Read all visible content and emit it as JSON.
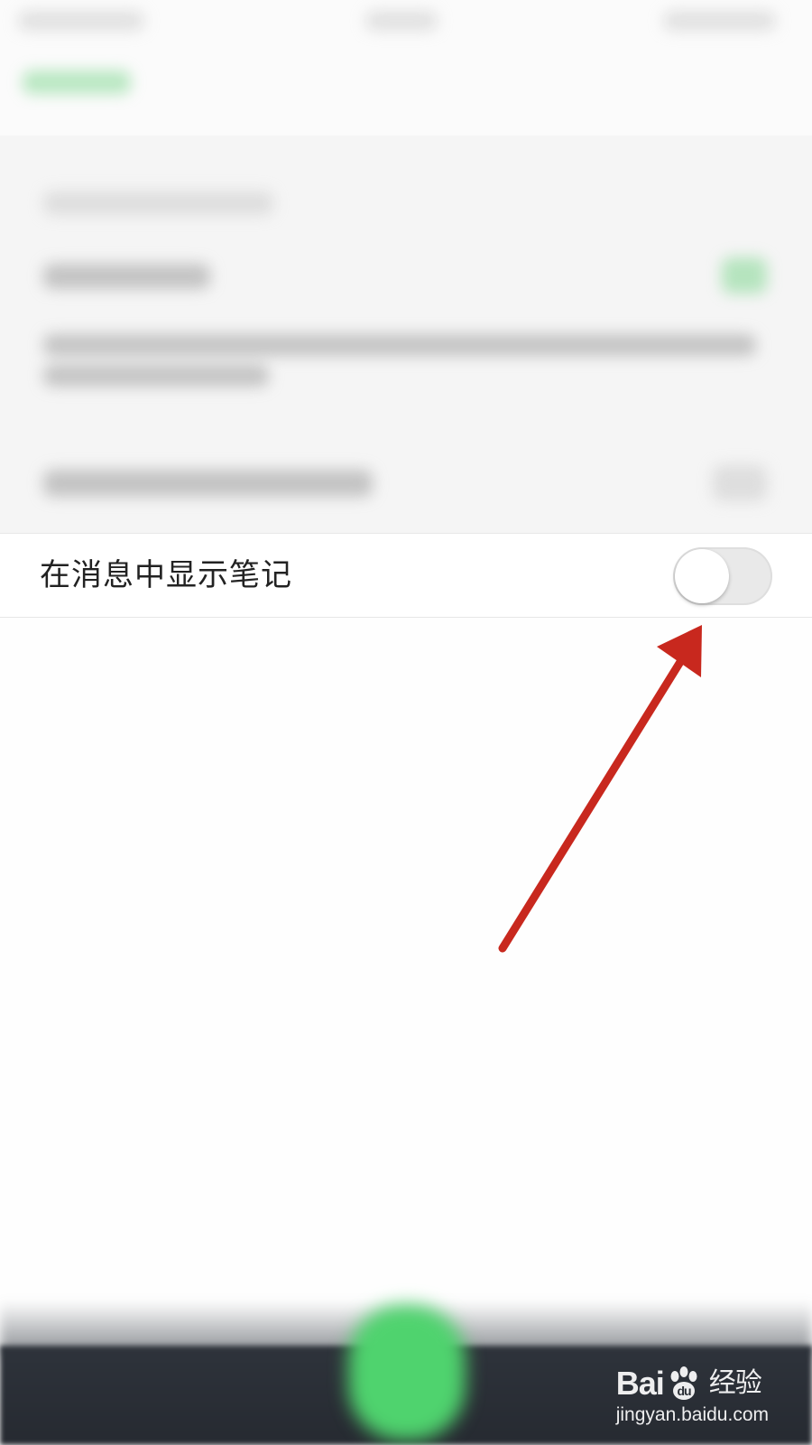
{
  "setting": {
    "label": "在消息中显示笔记",
    "toggle_on": false
  },
  "annotation": {
    "arrow_color": "#c8281e",
    "target": "toggle-switch"
  },
  "colors": {
    "accent_green": "#4fd36e",
    "bottom_bar": "#2a2e35"
  },
  "watermark": {
    "brand_left": "Bai",
    "brand_right": "经验",
    "url": "jingyan.baidu.com"
  }
}
